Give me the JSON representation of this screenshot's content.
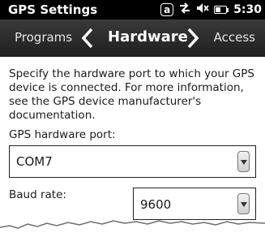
{
  "status_bar": {
    "title": "GPS Settings",
    "input_mode": "a",
    "time": "5:30"
  },
  "tabs": {
    "previous": "Programs",
    "current": "Hardware",
    "next": "Access"
  },
  "content": {
    "description": "Specify the hardware port to which your GPS device is connected. For more information, see the GPS device manufacturer's documentation.",
    "port_label": "GPS hardware port:",
    "port_value": "COM7",
    "baud_label": "Baud rate:",
    "baud_value": "9600"
  },
  "icons": [
    "input-mode-icon",
    "connectivity-icon",
    "speaker-muted-icon",
    "battery-icon",
    "chevron-left-icon",
    "chevron-right-icon",
    "dropdown-arrow-icon"
  ]
}
